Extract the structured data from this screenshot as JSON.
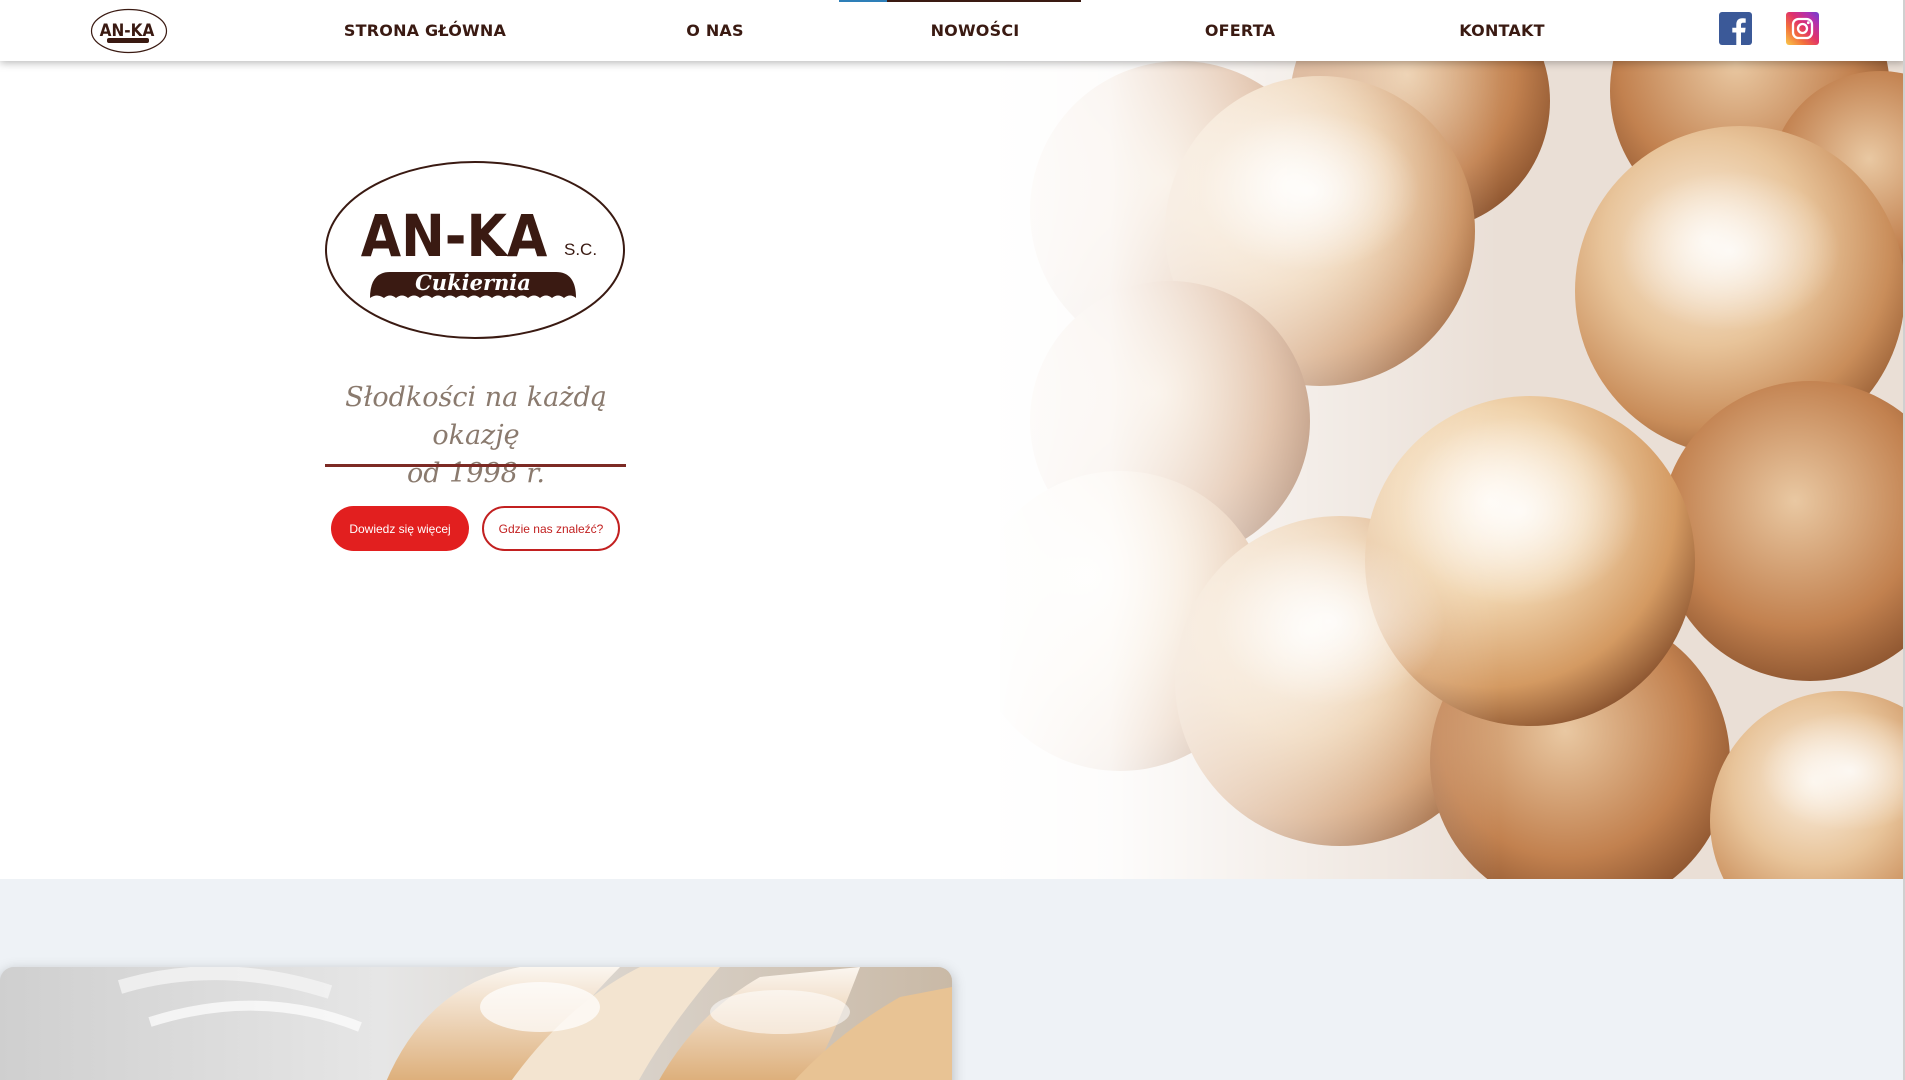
{
  "header": {
    "logo_text": "AN-KA",
    "nav": [
      {
        "label": "Strona główna",
        "active": false
      },
      {
        "label": "O nas",
        "active": false
      },
      {
        "label": "Nowości",
        "active": true
      },
      {
        "label": "Oferta",
        "active": false
      },
      {
        "label": "Kontakt",
        "active": false
      }
    ],
    "social": {
      "facebook_icon": "facebook-icon",
      "instagram_icon": "instagram-icon"
    }
  },
  "hero": {
    "logo": {
      "main": "AN-KA",
      "suffix": "S.C.",
      "sub": "Cukiernia"
    },
    "tagline_line1": "Słodkości na każdą okazję",
    "tagline_line2": "od 1998 r.",
    "primary_button": "Dowiedz się więcej",
    "secondary_button": "Gdzie nas znaleźć?"
  },
  "colors": {
    "nav_text": "#3a1a12",
    "primary": "#e21f1f",
    "accent_line": "#7c2a24",
    "section_bg": "#eef2f6"
  }
}
